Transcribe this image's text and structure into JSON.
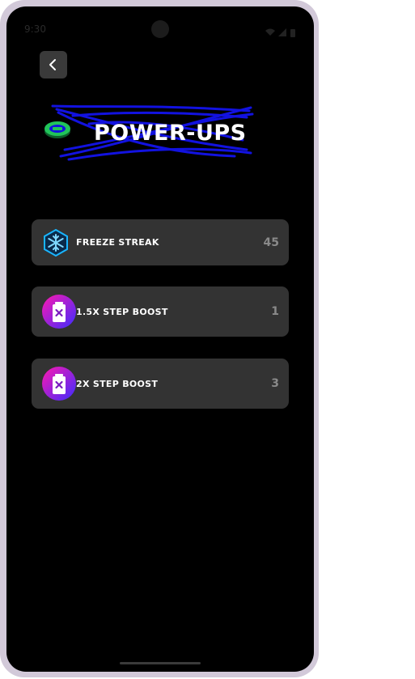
{
  "status_bar": {
    "time": "9:30"
  },
  "header": {
    "title": "POWER-UPS"
  },
  "powerups": [
    {
      "label": "FREEZE STREAK",
      "count": "45",
      "icon": "snowflake-icon"
    },
    {
      "label": "1.5X STEP BOOST",
      "count": "1",
      "icon": "battery-boost-icon"
    },
    {
      "label": "2X STEP BOOST",
      "count": "3",
      "icon": "battery-boost-icon"
    }
  ],
  "colors": {
    "scribble": "#1212e0",
    "coin": "#21c45a",
    "freeze_icon": "#19b5ff",
    "boost_gradient_start": "#ff18b0",
    "boost_gradient_end": "#3c2cff",
    "card_bg": "#333333"
  }
}
